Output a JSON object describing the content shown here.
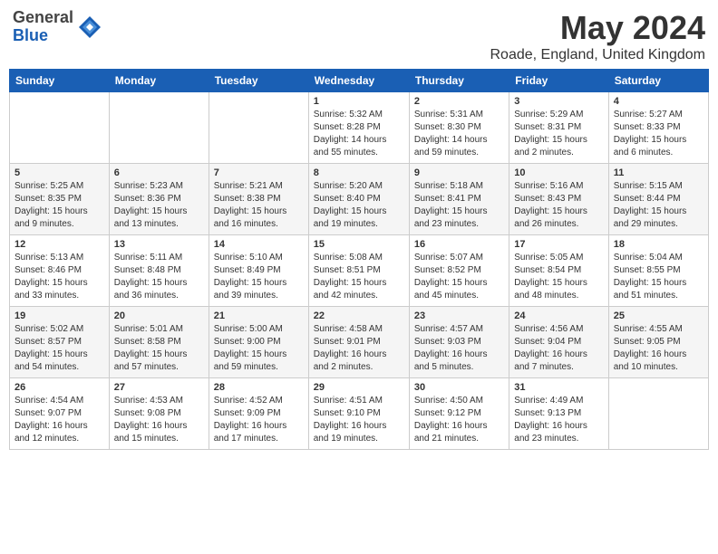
{
  "header": {
    "logo_general": "General",
    "logo_blue": "Blue",
    "title": "May 2024",
    "subtitle": "Roade, England, United Kingdom"
  },
  "calendar": {
    "days_of_week": [
      "Sunday",
      "Monday",
      "Tuesday",
      "Wednesday",
      "Thursday",
      "Friday",
      "Saturday"
    ],
    "weeks": [
      [
        {
          "day": "",
          "info": ""
        },
        {
          "day": "",
          "info": ""
        },
        {
          "day": "",
          "info": ""
        },
        {
          "day": "1",
          "info": "Sunrise: 5:32 AM\nSunset: 8:28 PM\nDaylight: 14 hours\nand 55 minutes."
        },
        {
          "day": "2",
          "info": "Sunrise: 5:31 AM\nSunset: 8:30 PM\nDaylight: 14 hours\nand 59 minutes."
        },
        {
          "day": "3",
          "info": "Sunrise: 5:29 AM\nSunset: 8:31 PM\nDaylight: 15 hours\nand 2 minutes."
        },
        {
          "day": "4",
          "info": "Sunrise: 5:27 AM\nSunset: 8:33 PM\nDaylight: 15 hours\nand 6 minutes."
        }
      ],
      [
        {
          "day": "5",
          "info": "Sunrise: 5:25 AM\nSunset: 8:35 PM\nDaylight: 15 hours\nand 9 minutes."
        },
        {
          "day": "6",
          "info": "Sunrise: 5:23 AM\nSunset: 8:36 PM\nDaylight: 15 hours\nand 13 minutes."
        },
        {
          "day": "7",
          "info": "Sunrise: 5:21 AM\nSunset: 8:38 PM\nDaylight: 15 hours\nand 16 minutes."
        },
        {
          "day": "8",
          "info": "Sunrise: 5:20 AM\nSunset: 8:40 PM\nDaylight: 15 hours\nand 19 minutes."
        },
        {
          "day": "9",
          "info": "Sunrise: 5:18 AM\nSunset: 8:41 PM\nDaylight: 15 hours\nand 23 minutes."
        },
        {
          "day": "10",
          "info": "Sunrise: 5:16 AM\nSunset: 8:43 PM\nDaylight: 15 hours\nand 26 minutes."
        },
        {
          "day": "11",
          "info": "Sunrise: 5:15 AM\nSunset: 8:44 PM\nDaylight: 15 hours\nand 29 minutes."
        }
      ],
      [
        {
          "day": "12",
          "info": "Sunrise: 5:13 AM\nSunset: 8:46 PM\nDaylight: 15 hours\nand 33 minutes."
        },
        {
          "day": "13",
          "info": "Sunrise: 5:11 AM\nSunset: 8:48 PM\nDaylight: 15 hours\nand 36 minutes."
        },
        {
          "day": "14",
          "info": "Sunrise: 5:10 AM\nSunset: 8:49 PM\nDaylight: 15 hours\nand 39 minutes."
        },
        {
          "day": "15",
          "info": "Sunrise: 5:08 AM\nSunset: 8:51 PM\nDaylight: 15 hours\nand 42 minutes."
        },
        {
          "day": "16",
          "info": "Sunrise: 5:07 AM\nSunset: 8:52 PM\nDaylight: 15 hours\nand 45 minutes."
        },
        {
          "day": "17",
          "info": "Sunrise: 5:05 AM\nSunset: 8:54 PM\nDaylight: 15 hours\nand 48 minutes."
        },
        {
          "day": "18",
          "info": "Sunrise: 5:04 AM\nSunset: 8:55 PM\nDaylight: 15 hours\nand 51 minutes."
        }
      ],
      [
        {
          "day": "19",
          "info": "Sunrise: 5:02 AM\nSunset: 8:57 PM\nDaylight: 15 hours\nand 54 minutes."
        },
        {
          "day": "20",
          "info": "Sunrise: 5:01 AM\nSunset: 8:58 PM\nDaylight: 15 hours\nand 57 minutes."
        },
        {
          "day": "21",
          "info": "Sunrise: 5:00 AM\nSunset: 9:00 PM\nDaylight: 15 hours\nand 59 minutes."
        },
        {
          "day": "22",
          "info": "Sunrise: 4:58 AM\nSunset: 9:01 PM\nDaylight: 16 hours\nand 2 minutes."
        },
        {
          "day": "23",
          "info": "Sunrise: 4:57 AM\nSunset: 9:03 PM\nDaylight: 16 hours\nand 5 minutes."
        },
        {
          "day": "24",
          "info": "Sunrise: 4:56 AM\nSunset: 9:04 PM\nDaylight: 16 hours\nand 7 minutes."
        },
        {
          "day": "25",
          "info": "Sunrise: 4:55 AM\nSunset: 9:05 PM\nDaylight: 16 hours\nand 10 minutes."
        }
      ],
      [
        {
          "day": "26",
          "info": "Sunrise: 4:54 AM\nSunset: 9:07 PM\nDaylight: 16 hours\nand 12 minutes."
        },
        {
          "day": "27",
          "info": "Sunrise: 4:53 AM\nSunset: 9:08 PM\nDaylight: 16 hours\nand 15 minutes."
        },
        {
          "day": "28",
          "info": "Sunrise: 4:52 AM\nSunset: 9:09 PM\nDaylight: 16 hours\nand 17 minutes."
        },
        {
          "day": "29",
          "info": "Sunrise: 4:51 AM\nSunset: 9:10 PM\nDaylight: 16 hours\nand 19 minutes."
        },
        {
          "day": "30",
          "info": "Sunrise: 4:50 AM\nSunset: 9:12 PM\nDaylight: 16 hours\nand 21 minutes."
        },
        {
          "day": "31",
          "info": "Sunrise: 4:49 AM\nSunset: 9:13 PM\nDaylight: 16 hours\nand 23 minutes."
        },
        {
          "day": "",
          "info": ""
        }
      ]
    ]
  }
}
